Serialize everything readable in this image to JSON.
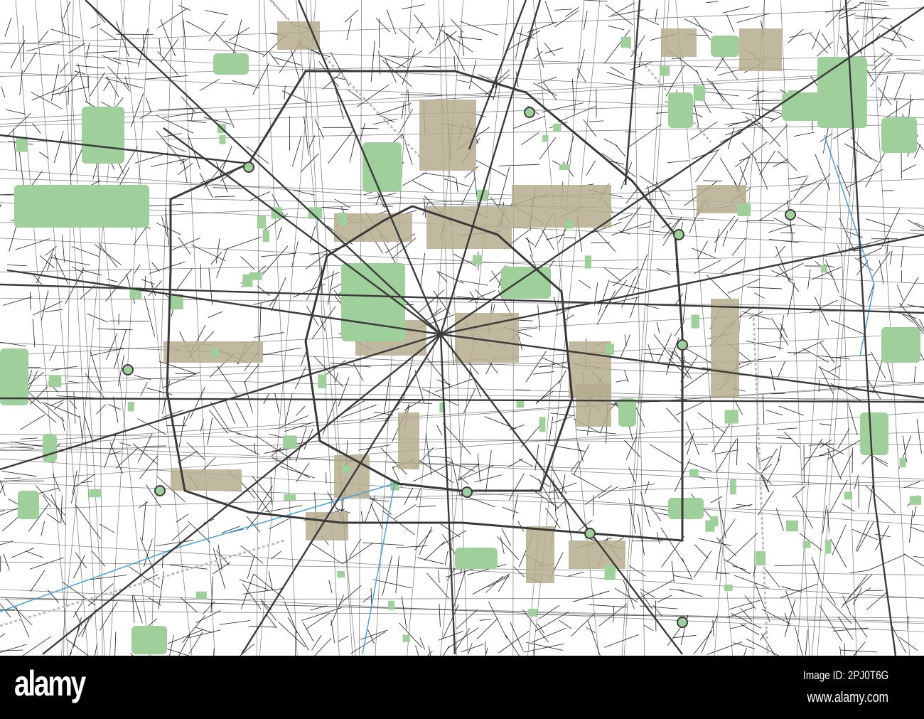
{
  "map": {
    "colors": {
      "background": "#ffffff",
      "road": "#3a3a3a",
      "street": "#1e1e1e",
      "park": "#9fcf9a",
      "district": "#b5ab8e",
      "water": "#4aa3d8",
      "rail": "#bdbdbd"
    }
  },
  "watermark": {
    "logo": "alamy",
    "image_id": "Image ID: 2PJ0T6G",
    "url": "www.alamy.com"
  }
}
